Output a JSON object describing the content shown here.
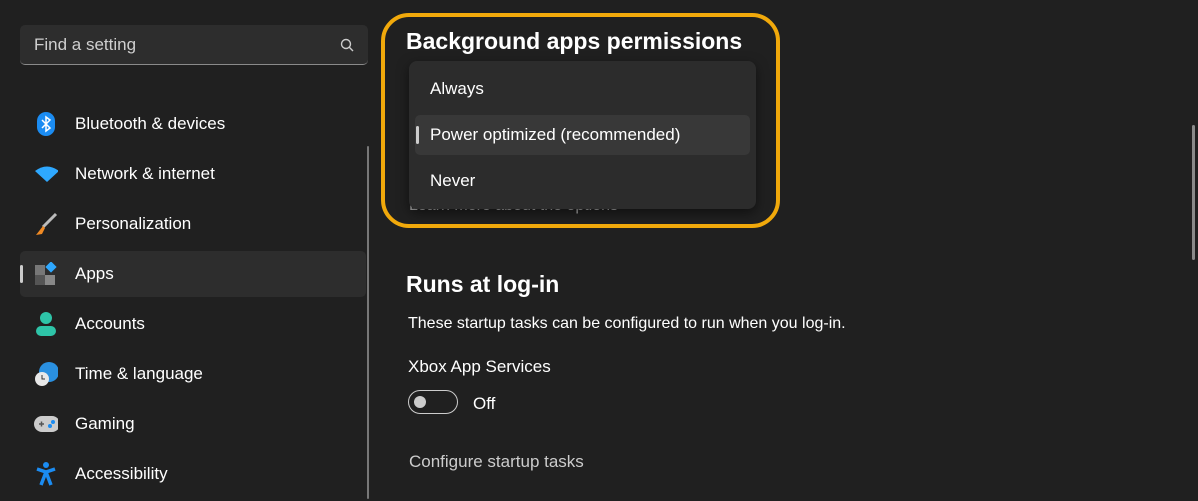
{
  "search": {
    "placeholder": "Find a setting"
  },
  "nav": [
    {
      "label": "Bluetooth & devices",
      "icon": "bluetooth-icon"
    },
    {
      "label": "Network & internet",
      "icon": "wifi-icon"
    },
    {
      "label": "Personalization",
      "icon": "brush-icon"
    },
    {
      "label": "Apps",
      "icon": "apps-icon",
      "selected": true
    },
    {
      "label": "Accounts",
      "icon": "person-icon"
    },
    {
      "label": "Time & language",
      "icon": "globe-clock-icon"
    },
    {
      "label": "Gaming",
      "icon": "gamepad-icon"
    },
    {
      "label": "Accessibility",
      "icon": "accessibility-icon"
    }
  ],
  "background": {
    "title": "Background apps permissions",
    "options": [
      "Always",
      "Power optimized (recommended)",
      "Never"
    ],
    "selected": "Power optimized (recommended)",
    "learn_more": "Learn more about the options"
  },
  "runs": {
    "title": "Runs at log-in",
    "description": "These startup tasks can be configured to run when you log-in.",
    "task_name": "Xbox App Services",
    "toggle_state": "Off",
    "configure_link": "Configure startup tasks"
  },
  "colors": {
    "highlight": "#f1a90b",
    "accent": "#0a84ff"
  }
}
